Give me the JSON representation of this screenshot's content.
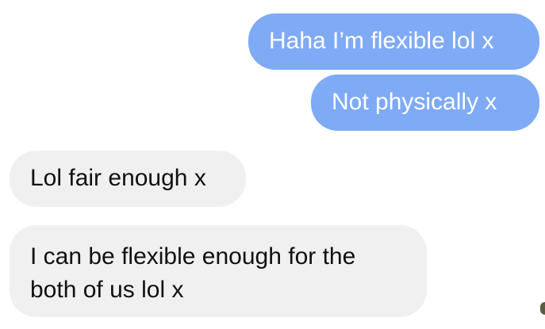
{
  "conversation": {
    "messages": [
      {
        "direction": "sent",
        "lines": [
          "Haha I’m flexible lol x"
        ]
      },
      {
        "direction": "sent",
        "lines": [
          "Not physically x"
        ]
      },
      {
        "direction": "received",
        "lines": [
          "Lol fair enough x"
        ]
      },
      {
        "direction": "received",
        "lines": [
          "I can be flexible enough for the",
          "both of us lol x"
        ]
      }
    ]
  },
  "colors": {
    "sent_bubble": "#7faaf6",
    "received_bubble": "#f0f0f0",
    "sent_text": "#ffffff",
    "received_text": "#111111"
  }
}
